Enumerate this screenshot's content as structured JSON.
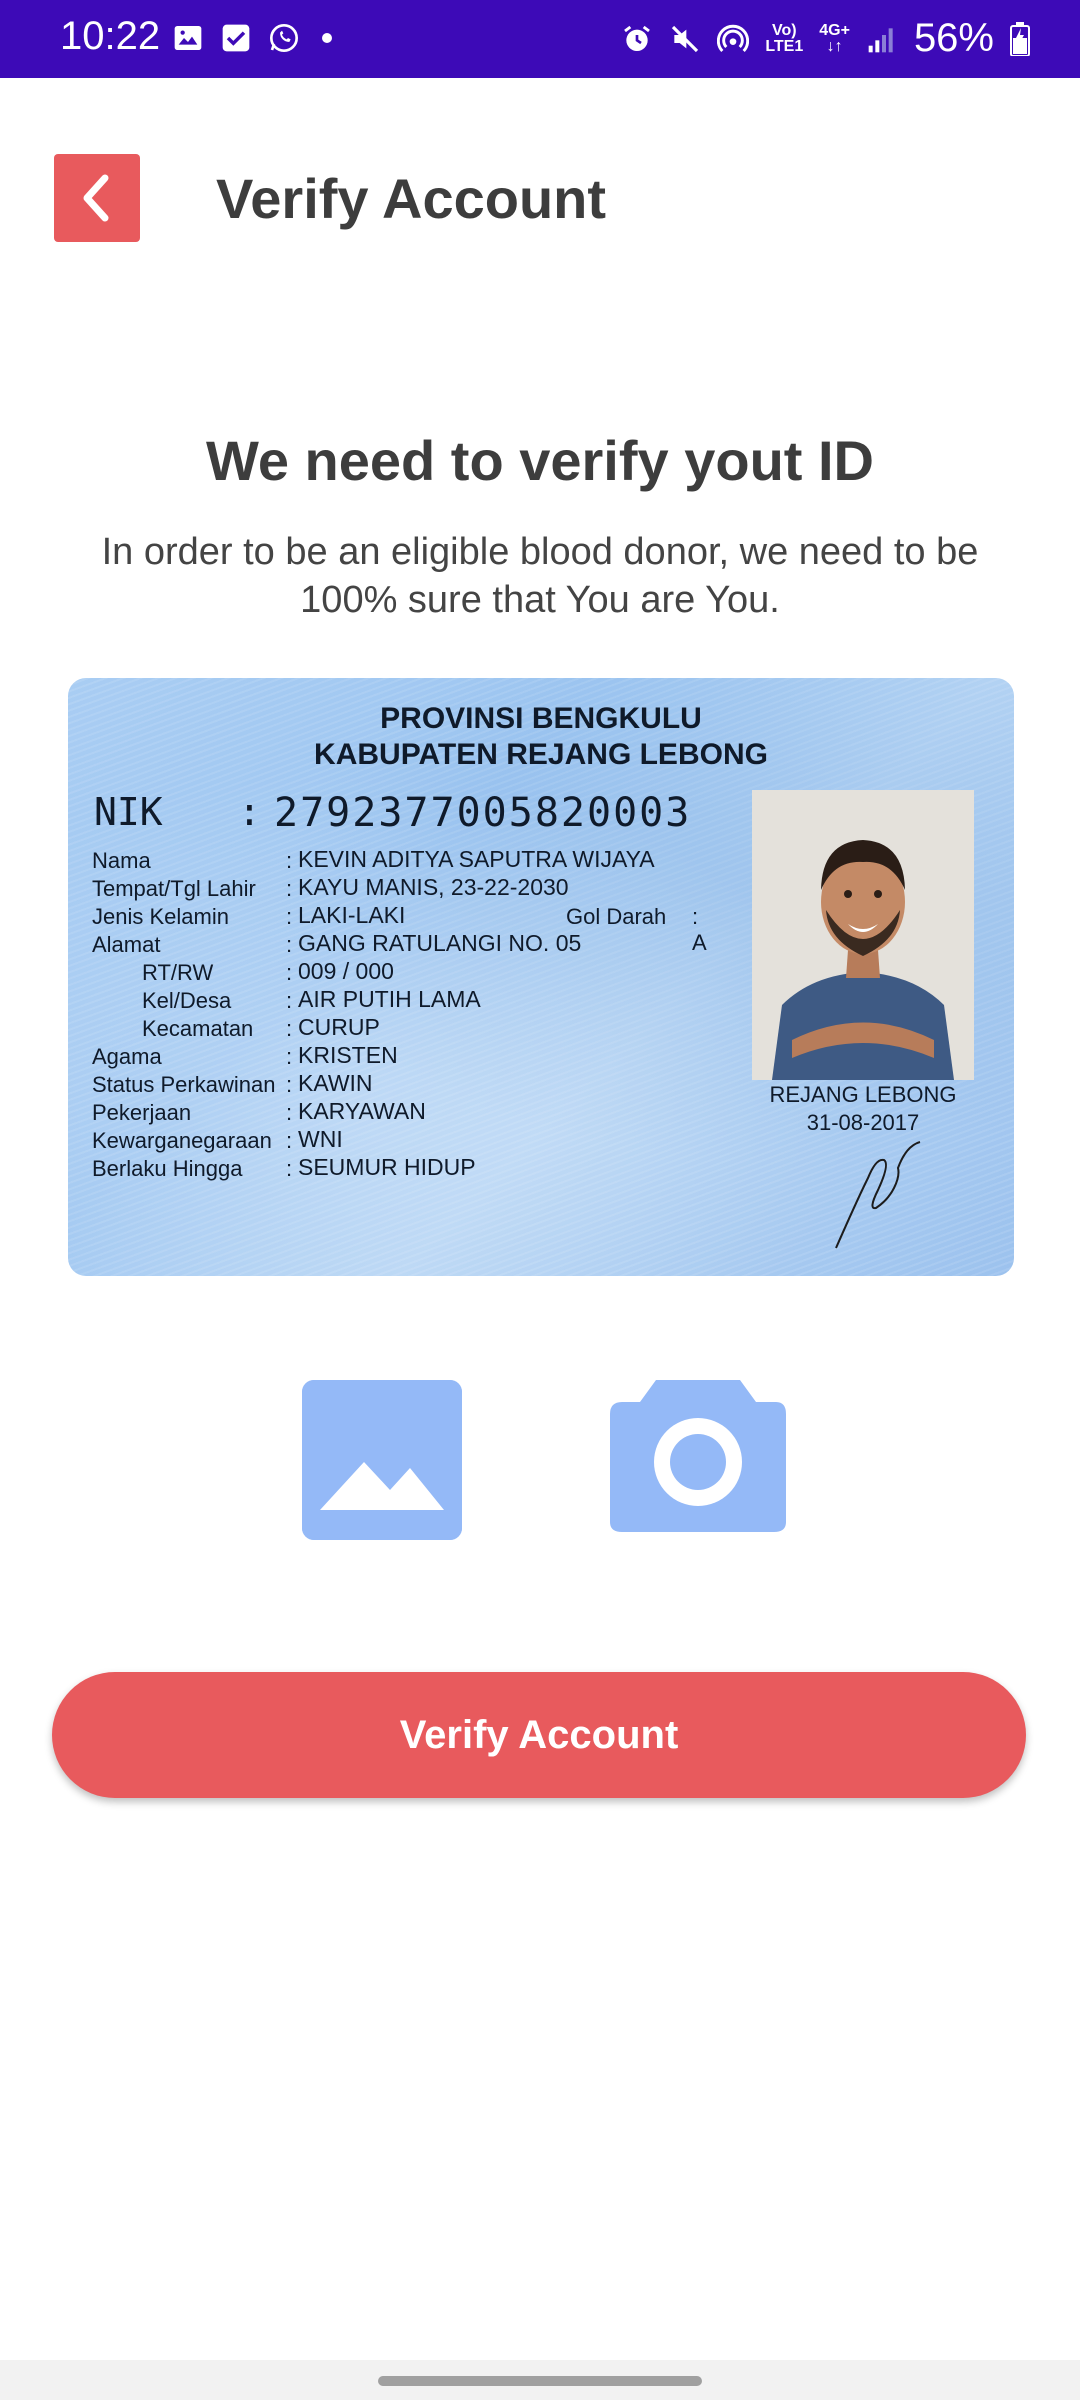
{
  "status_bar": {
    "time": "10:22",
    "network_top": "Vo)",
    "network_bottom": "LTE1",
    "net_type_top": "4G+",
    "net_type_bottom": "↓↑",
    "battery": "56%"
  },
  "header": {
    "title": "Verify Account"
  },
  "intro": {
    "heading": "We need to verify yout ID",
    "subtext": "In order to be an eligible blood donor, we need to be 100% sure that You are You."
  },
  "id_card": {
    "province": "PROVINSI BENGKULU",
    "regency": "KABUPATEN REJANG LEBONG",
    "nik_label": "NIK",
    "nik_colon": ":",
    "nik": "2792377005820003",
    "rows": [
      {
        "label": "Nama",
        "value": "KEVIN ADITYA SAPUTRA WIJAYA"
      },
      {
        "label": "Tempat/Tgl Lahir",
        "value": "KAYU MANIS, 23-22-2030"
      },
      {
        "label": "Jenis Kelamin",
        "value": "LAKI-LAKI"
      },
      {
        "label": "Alamat",
        "value": "GANG RATULANGI NO. 05"
      },
      {
        "label": "RT/RW",
        "value": "009 / 000"
      },
      {
        "label": "Kel/Desa",
        "value": "AIR PUTIH LAMA"
      },
      {
        "label": "Kecamatan",
        "value": "CURUP"
      },
      {
        "label": "Agama",
        "value": "KRISTEN"
      },
      {
        "label": "Status Perkawinan",
        "value": "KAWIN"
      },
      {
        "label": "Pekerjaan",
        "value": "KARYAWAN"
      },
      {
        "label": "Kewarganegaraan",
        "value": "WNI"
      },
      {
        "label": "Berlaku Hingga",
        "value": "SEUMUR HIDUP"
      }
    ],
    "colon": ":",
    "blood_label": "Gol Darah",
    "blood_value": ": A",
    "issue_place": "REJANG LEBONG",
    "issue_date": "31-08-2017"
  },
  "actions": {
    "verify_label": "Verify Account"
  },
  "colors": {
    "status_bar": "#3d0ab7",
    "accent": "#e85a5d",
    "icon_blue": "#94b9f7"
  },
  "icons": {
    "back": "chevron-left-icon",
    "gallery": "image-icon",
    "camera": "camera-icon"
  }
}
